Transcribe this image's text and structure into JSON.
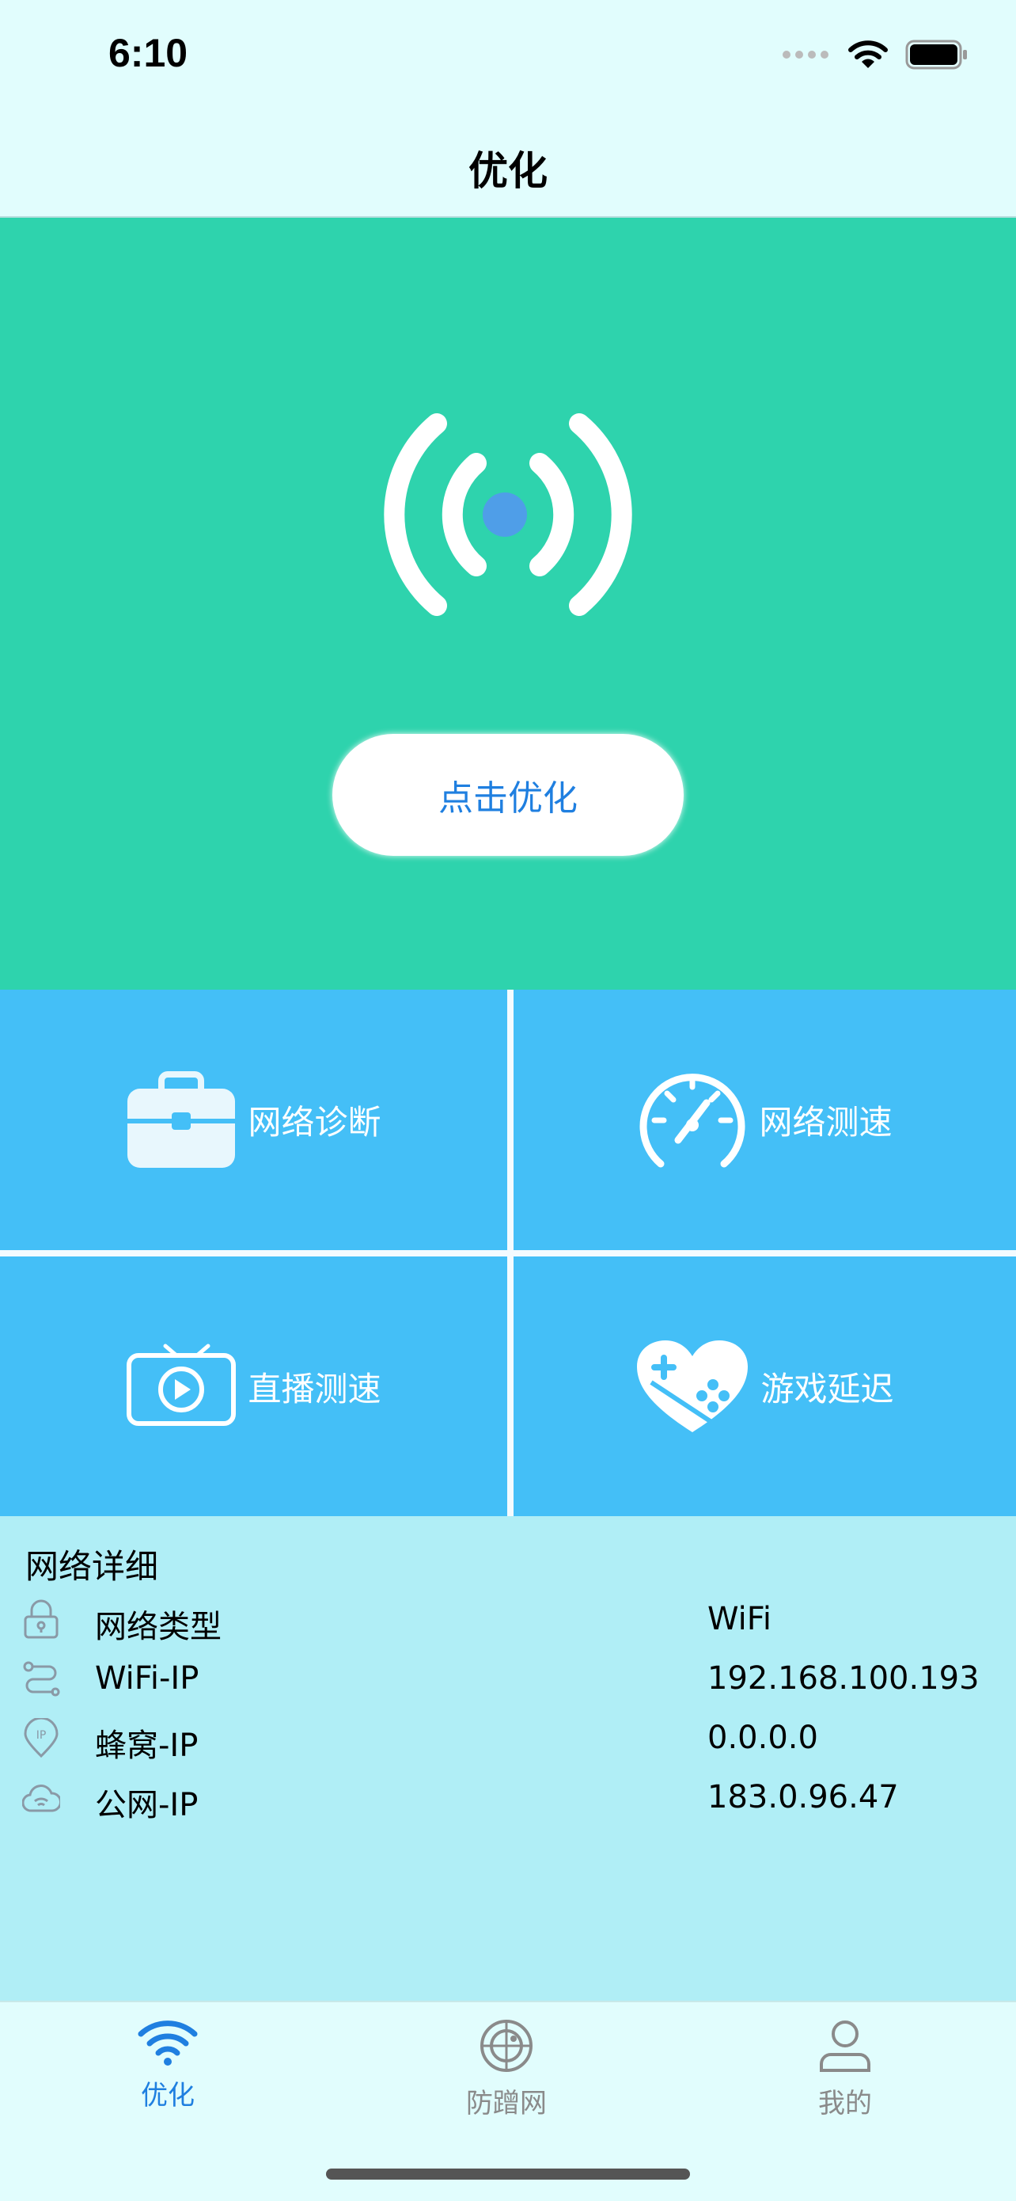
{
  "status_bar": {
    "time": "6:10"
  },
  "nav": {
    "title": "优化"
  },
  "hero": {
    "button_label": "点击优化"
  },
  "tools": [
    {
      "label": "网络诊断",
      "icon": "toolbox-icon"
    },
    {
      "label": "网络测速",
      "icon": "speedometer-icon"
    },
    {
      "label": "直播测速",
      "icon": "tv-play-icon"
    },
    {
      "label": "游戏延迟",
      "icon": "gamepad-heart-icon"
    }
  ],
  "details": {
    "title": "网络详细",
    "rows": [
      {
        "label": "网络类型",
        "value": "WiFi",
        "icon": "lock-icon"
      },
      {
        "label": "WiFi-IP",
        "value": "192.168.100.193",
        "icon": "route-icon"
      },
      {
        "label": "蜂窝-IP",
        "value": "0.0.0.0",
        "icon": "ip-pin-icon"
      },
      {
        "label": "公网-IP",
        "value": "183.0.96.47",
        "icon": "cloud-wifi-icon"
      }
    ]
  },
  "tabbar": {
    "items": [
      {
        "label": "优化",
        "icon": "wifi-icon",
        "active": true
      },
      {
        "label": "防蹭网",
        "icon": "radar-icon",
        "active": false
      },
      {
        "label": "我的",
        "icon": "user-icon",
        "active": false
      }
    ]
  },
  "colors": {
    "hero_bg": "#2ed3ad",
    "tile_bg": "#44bff7",
    "details_bg": "#b0eef6",
    "accent": "#1f7fe0",
    "page_bg": "#e1fdfd"
  }
}
